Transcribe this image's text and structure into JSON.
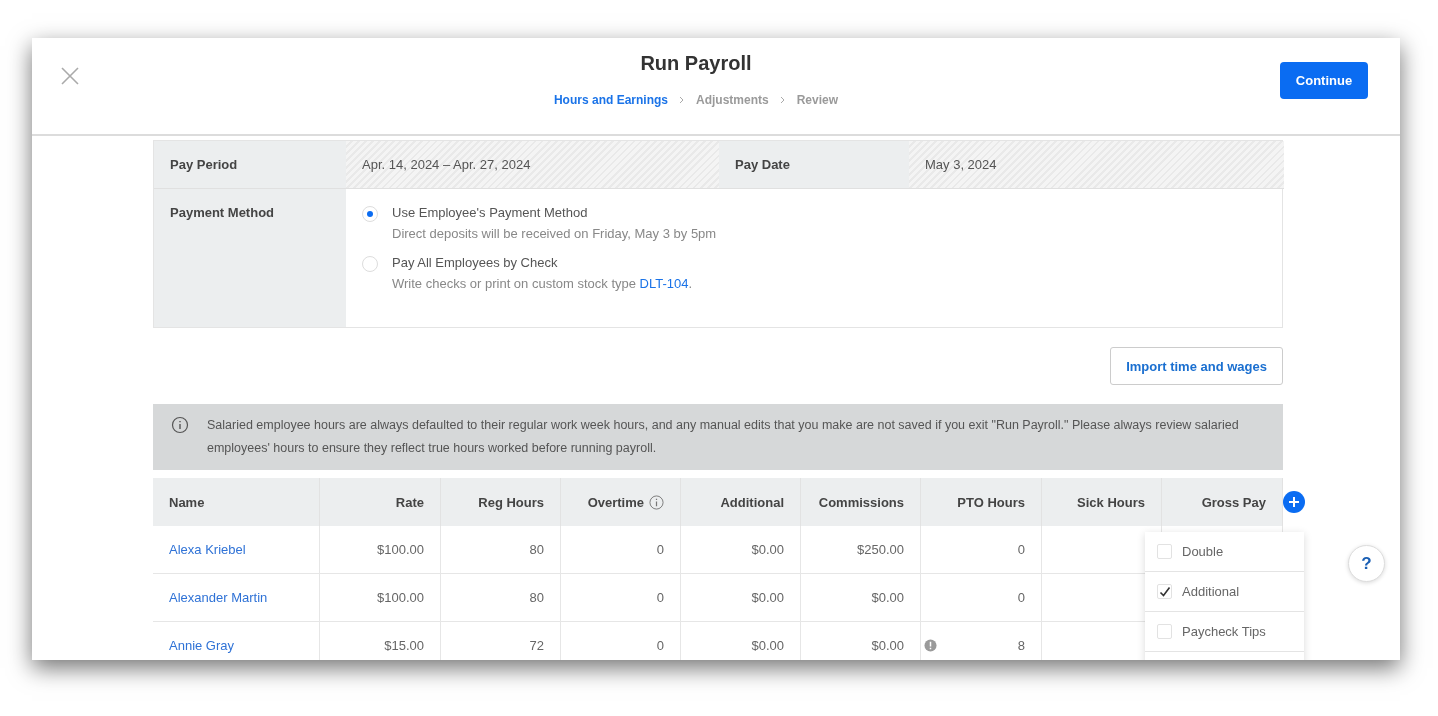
{
  "dialog": {
    "title": "Run Payroll",
    "steps": [
      {
        "label": "Hours and Earnings",
        "selected": true
      },
      {
        "label": "Adjustments",
        "selected": false
      },
      {
        "label": "Review",
        "selected": false
      }
    ],
    "continue_button": "Continue"
  },
  "summary": {
    "pay_period": {
      "label": "Pay Period",
      "value": "Apr. 14, 2024 – Apr. 27, 2024"
    },
    "pay_date": {
      "label": "Pay Date",
      "value": "May 3, 2024"
    },
    "payment_method": {
      "label": "Payment Method",
      "options": [
        {
          "label": "Use Employee's Payment Method",
          "description": "Direct deposits will be received on Friday, May 3 by 5pm",
          "selected": true
        },
        {
          "label": "Pay All Employees by Check",
          "description": "Write checks or print on custom stock type ",
          "link": "DLT-104",
          "suffix": ".",
          "selected": false
        }
      ]
    }
  },
  "import_button": "Import time and wages",
  "notice": "Salaried employee hours are always defaulted to their regular work week hours, and any manual edits that you make are not saved if you exit \"Run Payroll.\" Please always review salaried employees' hours to ensure they reflect true hours worked before running payroll.",
  "table": {
    "columns": [
      {
        "label": "Name",
        "info": false
      },
      {
        "label": "Rate",
        "info": false
      },
      {
        "label": "Reg Hours",
        "info": false
      },
      {
        "label": "Overtime",
        "info": true
      },
      {
        "label": "Additional",
        "info": false
      },
      {
        "label": "Commissions",
        "info": false
      },
      {
        "label": "PTO Hours",
        "info": false
      },
      {
        "label": "Sick Hours",
        "info": false
      },
      {
        "label": "Gross Pay",
        "info": false
      }
    ],
    "rows": [
      {
        "name": "Alexa Kriebel",
        "rate": "$100.00",
        "reg_hours": "80",
        "overtime": "0",
        "additional": "$0.00",
        "commissions": "$250.00",
        "pto_hours": "0",
        "pto_alert": false
      },
      {
        "name": "Alexander Martin",
        "rate": "$100.00",
        "reg_hours": "80",
        "overtime": "0",
        "additional": "$0.00",
        "commissions": "$0.00",
        "pto_hours": "0",
        "pto_alert": false
      },
      {
        "name": "Annie Gray",
        "rate": "$15.00",
        "reg_hours": "72",
        "overtime": "0",
        "additional": "$0.00",
        "commissions": "$0.00",
        "pto_hours": "8",
        "pto_alert": true
      }
    ]
  },
  "column_menu": {
    "items": [
      {
        "label": "Double",
        "checked": false
      },
      {
        "label": "Additional",
        "checked": true
      },
      {
        "label": "Paycheck Tips",
        "checked": false
      }
    ]
  },
  "help_button": "?"
}
